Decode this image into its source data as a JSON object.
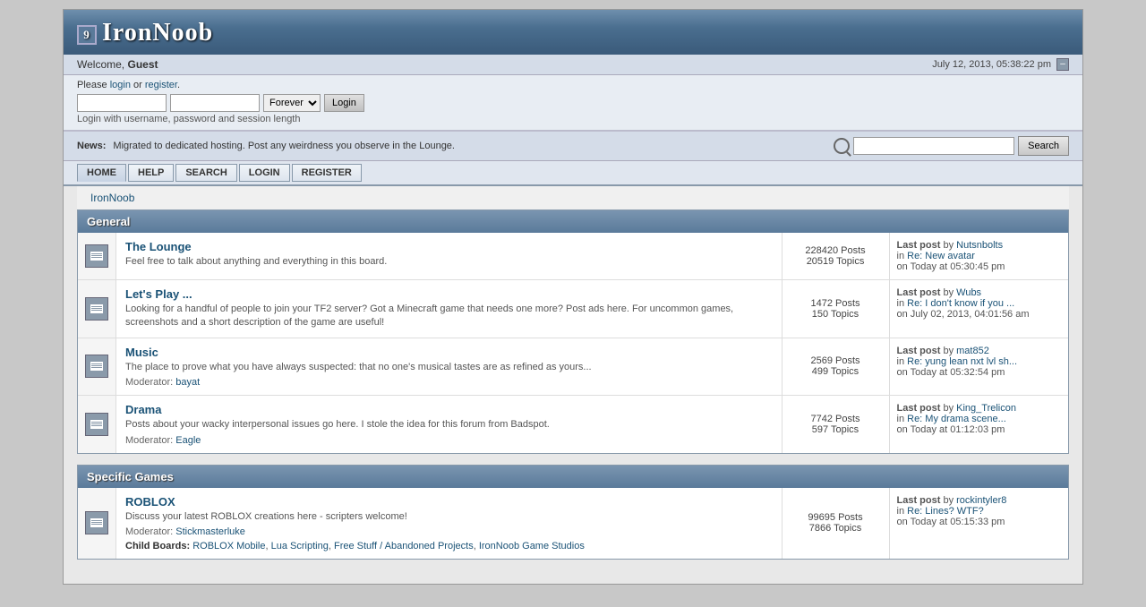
{
  "site": {
    "title": "IronNoob",
    "logo_icon": "9"
  },
  "header": {
    "welcome_prefix": "Welcome,",
    "username": "Guest",
    "datetime": "July 12, 2013, 05:38:22 pm"
  },
  "login": {
    "prompt": "Please",
    "login_link": "login",
    "or_text": "or",
    "register_link": "register",
    "period": ".",
    "duration_options": [
      "Forever"
    ],
    "duration_selected": "Forever",
    "login_button": "Login",
    "hint": "Login with username, password and session length"
  },
  "news": {
    "label": "News:",
    "text": "Migrated to dedicated hosting. Post any weirdness you observe in the Lounge."
  },
  "search": {
    "button_label": "Search",
    "placeholder": ""
  },
  "nav": {
    "items": [
      {
        "label": "HOME",
        "active": true
      },
      {
        "label": "HELP",
        "active": false
      },
      {
        "label": "SEARCH",
        "active": false
      },
      {
        "label": "LOGIN",
        "active": false
      },
      {
        "label": "REGISTER",
        "active": false
      }
    ]
  },
  "breadcrumb": "IronNoob",
  "categories": [
    {
      "name": "General",
      "forums": [
        {
          "name": "The Lounge",
          "description": "Feel free to talk about anything and everything in this board.",
          "moderator": null,
          "child_boards": null,
          "posts": "228420 Posts",
          "topics": "20519 Topics",
          "last_post_by": "Nutsnbolts",
          "last_post_in": "Re: New avatar",
          "last_post_on": "Today",
          "last_post_time": "at 05:30:45 pm"
        },
        {
          "name": "Let's Play ...",
          "description": "Looking for a handful of people to join your TF2 server? Got a Minecraft game that needs one more? Post ads here. For uncommon games, screenshots and a short description of the game are useful!",
          "moderator": null,
          "child_boards": null,
          "posts": "1472 Posts",
          "topics": "150 Topics",
          "last_post_by": "Wubs",
          "last_post_in": "Re: I don't know if you ...",
          "last_post_on": "July 02, 2013,",
          "last_post_time": "04:01:56 am"
        },
        {
          "name": "Music",
          "description": "The place to prove what you have always suspected: that no one's musical tastes are as refined as yours...",
          "moderator": "bayat",
          "child_boards": null,
          "posts": "2569 Posts",
          "topics": "499 Topics",
          "last_post_by": "mat852",
          "last_post_in": "Re: yung lean nxt lvl sh...",
          "last_post_on": "Today",
          "last_post_time": "at 05:32:54 pm"
        },
        {
          "name": "Drama",
          "description": "Posts about your wacky interpersonal issues go here. I stole the idea for this forum from Badspot.",
          "moderator": "Eagle",
          "child_boards": null,
          "posts": "7742 Posts",
          "topics": "597 Topics",
          "last_post_by": "King_Trelicon",
          "last_post_in": "Re: My drama scene...",
          "last_post_on": "Today",
          "last_post_time": "at 01:12:03 pm"
        }
      ]
    },
    {
      "name": "Specific Games",
      "forums": [
        {
          "name": "ROBLOX",
          "description": "Discuss your latest ROBLOX creations here - scripters welcome!",
          "moderator": "Stickmasterluke",
          "child_boards": [
            "ROBLOX Mobile",
            "Lua Scripting",
            "Free Stuff / Abandoned Projects",
            "IronNoob Game Studios"
          ],
          "posts": "99695 Posts",
          "topics": "7866 Topics",
          "last_post_by": "rockintyler8",
          "last_post_in": "Re: Lines? WTF?",
          "last_post_on": "Today",
          "last_post_time": "at 05:15:33 pm"
        }
      ]
    }
  ]
}
